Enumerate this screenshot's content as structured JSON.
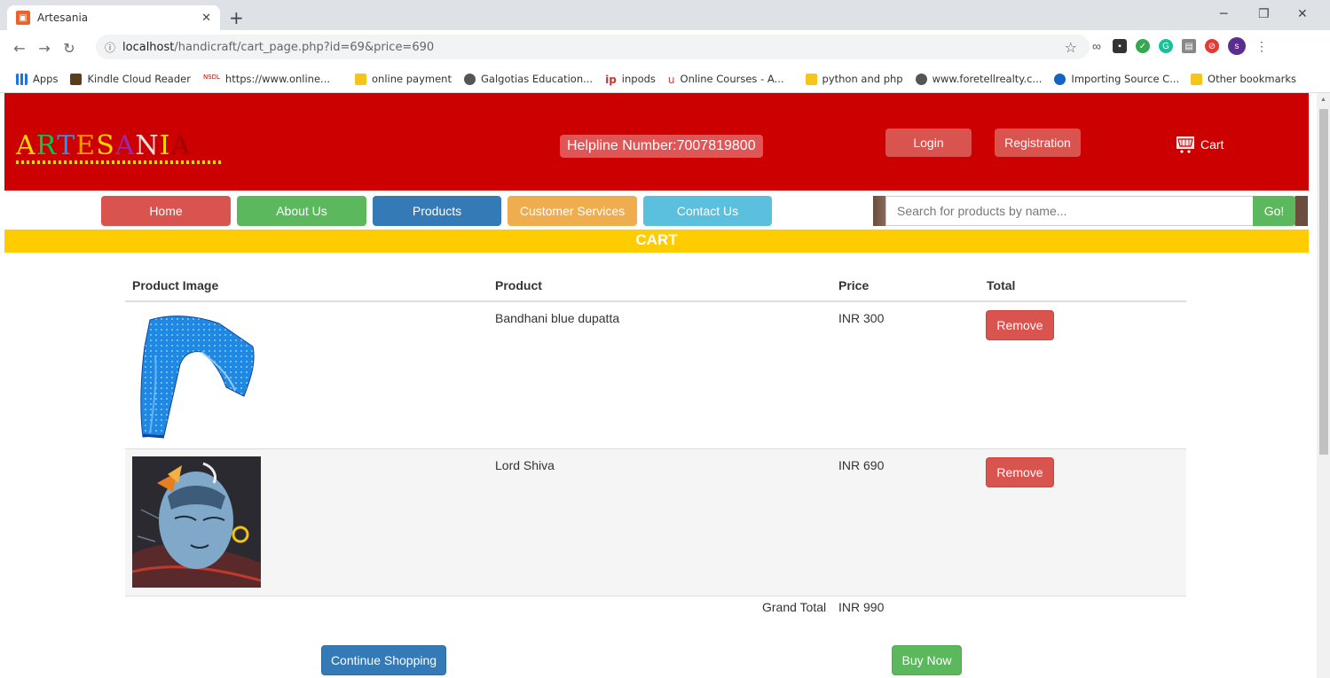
{
  "browser": {
    "tab_title": "Artesania",
    "url_host": "localhost",
    "url_path": "/handicraft/cart_page.php?id=69&price=690",
    "bookmarks": [
      {
        "label": "Apps"
      },
      {
        "label": "Kindle Cloud Reader"
      },
      {
        "label": "https://www.online..."
      },
      {
        "label": "online payment"
      },
      {
        "label": "Galgotias Education..."
      },
      {
        "label": "inpods"
      },
      {
        "label": "Online Courses - A..."
      },
      {
        "label": "python and php"
      },
      {
        "label": "www.foretellrealty.c..."
      },
      {
        "label": "Importing Source C..."
      }
    ],
    "other_bookmarks": "Other bookmarks",
    "profile_initial": "s"
  },
  "header": {
    "logo_letters": [
      "A",
      "R",
      "T",
      "E",
      "S",
      "A",
      "N",
      "I",
      "A"
    ],
    "logo_colors": [
      "#ffd700",
      "#00c853",
      "#2196f3",
      "#ff9800",
      "#ffd700",
      "#9c27b0",
      "#e0e0e0",
      "#ffd700",
      "#a00000"
    ],
    "helpline": "Helpline Number:7007819800",
    "login_label": "Login",
    "registration_label": "Registration",
    "cart_label": "Cart"
  },
  "nav": {
    "items": [
      {
        "label": "Home",
        "color": "#d9534f"
      },
      {
        "label": "About Us",
        "color": "#5cb85c"
      },
      {
        "label": "Products",
        "color": "#337ab7"
      },
      {
        "label": "Customer Services",
        "color": "#f0ad4e"
      },
      {
        "label": "Contact Us",
        "color": "#5bc0de"
      }
    ],
    "search_placeholder": "Search for products by name...",
    "go_label": "Go!"
  },
  "cart": {
    "title": "CART",
    "columns": [
      "Product Image",
      "Product",
      "Price",
      "Total"
    ],
    "rows": [
      {
        "product": "Bandhani blue dupatta",
        "price": "INR 300",
        "action": "Remove"
      },
      {
        "product": "Lord Shiva",
        "price": "INR 690",
        "action": "Remove"
      }
    ],
    "grand_total_label": "Grand Total",
    "grand_total_value": "INR 990",
    "continue_label": "Continue Shopping",
    "buy_label": "Buy Now"
  }
}
